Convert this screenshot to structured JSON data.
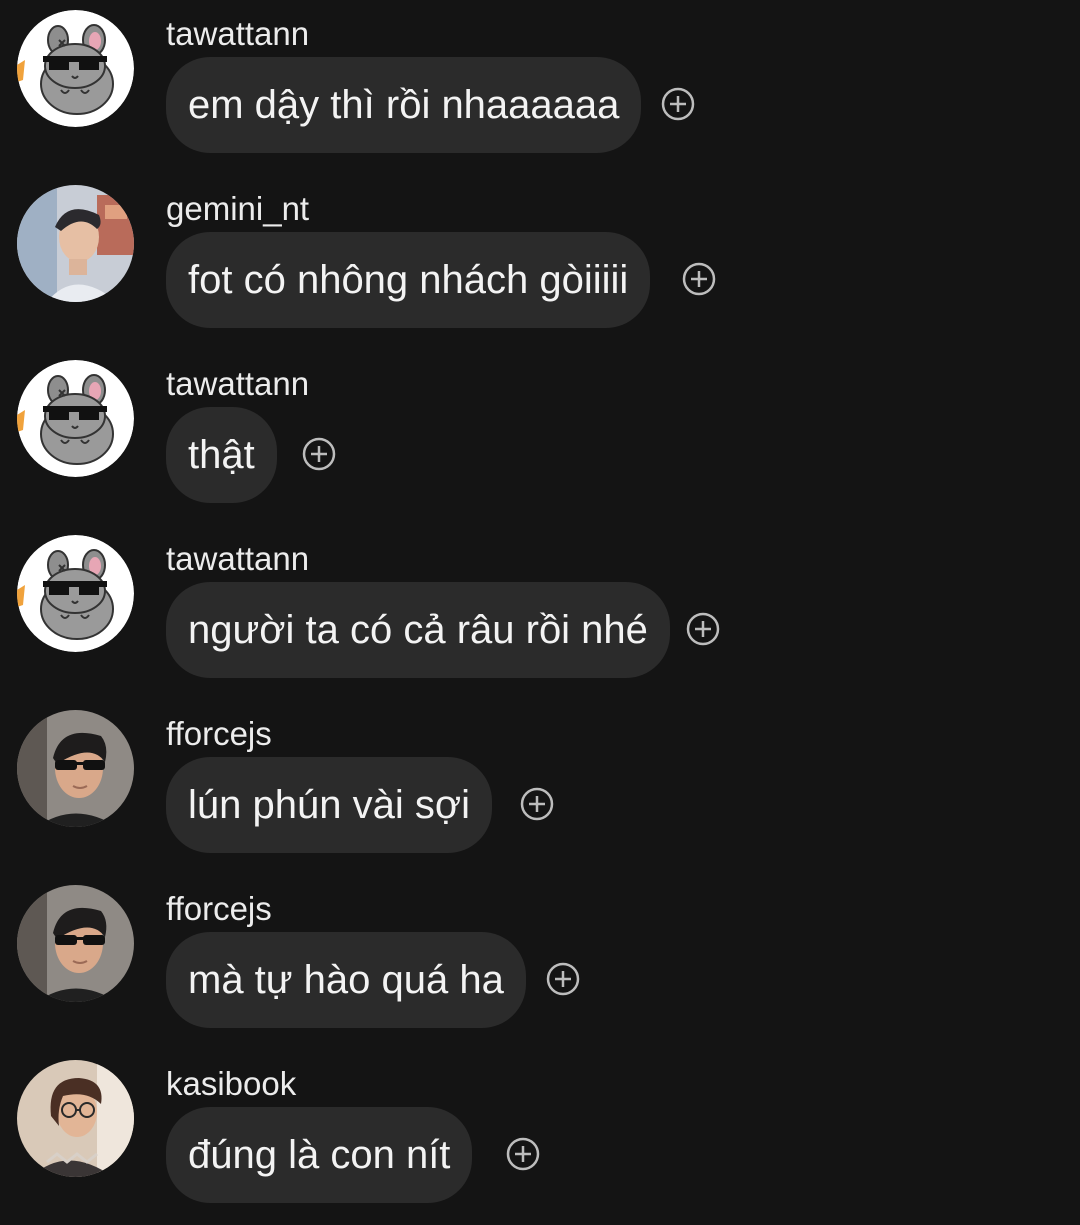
{
  "messages": [
    {
      "username": "tawattann",
      "text": "em dậy thì rồi nhaaaaaa",
      "avatar": "chinchilla-sunglasses-avatar"
    },
    {
      "username": "gemini_nt",
      "text": "fot có nhông nhách gòiiiii",
      "avatar": "person-photo-avatar"
    },
    {
      "username": "tawattann",
      "text": "thật",
      "avatar": "chinchilla-sunglasses-avatar"
    },
    {
      "username": "tawattann",
      "text": "người ta có cả râu rồi nhé",
      "avatar": "chinchilla-sunglasses-avatar"
    },
    {
      "username": "fforcejs",
      "text": "lún phún vài sợi",
      "avatar": "person-sunglasses-avatar"
    },
    {
      "username": "fforcejs",
      "text": "mà tự hào quá ha",
      "avatar": "person-sunglasses-avatar"
    },
    {
      "username": "kasibook",
      "text": "đúng là con nít",
      "avatar": "person-glasses-avatar"
    }
  ],
  "icons": {
    "react": "add-reaction-icon"
  },
  "colors": {
    "background": "#141414",
    "bubble": "#2b2b2b",
    "text": "#f3f3f3",
    "icon": "#bdbdbd"
  }
}
